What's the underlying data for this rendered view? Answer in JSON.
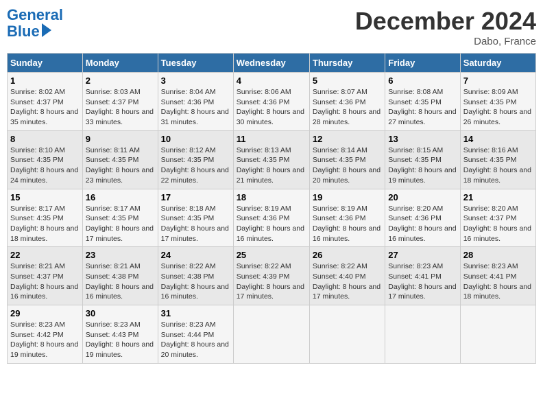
{
  "logo": {
    "line1": "General",
    "line2": "Blue"
  },
  "title": "December 2024",
  "subtitle": "Dabo, France",
  "days_header": [
    "Sunday",
    "Monday",
    "Tuesday",
    "Wednesday",
    "Thursday",
    "Friday",
    "Saturday"
  ],
  "weeks": [
    [
      {
        "day": "1",
        "sunrise": "8:02 AM",
        "sunset": "4:37 PM",
        "daylight": "8 hours and 35 minutes."
      },
      {
        "day": "2",
        "sunrise": "8:03 AM",
        "sunset": "4:37 PM",
        "daylight": "8 hours and 33 minutes."
      },
      {
        "day": "3",
        "sunrise": "8:04 AM",
        "sunset": "4:36 PM",
        "daylight": "8 hours and 31 minutes."
      },
      {
        "day": "4",
        "sunrise": "8:06 AM",
        "sunset": "4:36 PM",
        "daylight": "8 hours and 30 minutes."
      },
      {
        "day": "5",
        "sunrise": "8:07 AM",
        "sunset": "4:36 PM",
        "daylight": "8 hours and 28 minutes."
      },
      {
        "day": "6",
        "sunrise": "8:08 AM",
        "sunset": "4:35 PM",
        "daylight": "8 hours and 27 minutes."
      },
      {
        "day": "7",
        "sunrise": "8:09 AM",
        "sunset": "4:35 PM",
        "daylight": "8 hours and 26 minutes."
      }
    ],
    [
      {
        "day": "8",
        "sunrise": "8:10 AM",
        "sunset": "4:35 PM",
        "daylight": "8 hours and 24 minutes."
      },
      {
        "day": "9",
        "sunrise": "8:11 AM",
        "sunset": "4:35 PM",
        "daylight": "8 hours and 23 minutes."
      },
      {
        "day": "10",
        "sunrise": "8:12 AM",
        "sunset": "4:35 PM",
        "daylight": "8 hours and 22 minutes."
      },
      {
        "day": "11",
        "sunrise": "8:13 AM",
        "sunset": "4:35 PM",
        "daylight": "8 hours and 21 minutes."
      },
      {
        "day": "12",
        "sunrise": "8:14 AM",
        "sunset": "4:35 PM",
        "daylight": "8 hours and 20 minutes."
      },
      {
        "day": "13",
        "sunrise": "8:15 AM",
        "sunset": "4:35 PM",
        "daylight": "8 hours and 19 minutes."
      },
      {
        "day": "14",
        "sunrise": "8:16 AM",
        "sunset": "4:35 PM",
        "daylight": "8 hours and 18 minutes."
      }
    ],
    [
      {
        "day": "15",
        "sunrise": "8:17 AM",
        "sunset": "4:35 PM",
        "daylight": "8 hours and 18 minutes."
      },
      {
        "day": "16",
        "sunrise": "8:17 AM",
        "sunset": "4:35 PM",
        "daylight": "8 hours and 17 minutes."
      },
      {
        "day": "17",
        "sunrise": "8:18 AM",
        "sunset": "4:35 PM",
        "daylight": "8 hours and 17 minutes."
      },
      {
        "day": "18",
        "sunrise": "8:19 AM",
        "sunset": "4:36 PM",
        "daylight": "8 hours and 16 minutes."
      },
      {
        "day": "19",
        "sunrise": "8:19 AM",
        "sunset": "4:36 PM",
        "daylight": "8 hours and 16 minutes."
      },
      {
        "day": "20",
        "sunrise": "8:20 AM",
        "sunset": "4:36 PM",
        "daylight": "8 hours and 16 minutes."
      },
      {
        "day": "21",
        "sunrise": "8:20 AM",
        "sunset": "4:37 PM",
        "daylight": "8 hours and 16 minutes."
      }
    ],
    [
      {
        "day": "22",
        "sunrise": "8:21 AM",
        "sunset": "4:37 PM",
        "daylight": "8 hours and 16 minutes."
      },
      {
        "day": "23",
        "sunrise": "8:21 AM",
        "sunset": "4:38 PM",
        "daylight": "8 hours and 16 minutes."
      },
      {
        "day": "24",
        "sunrise": "8:22 AM",
        "sunset": "4:38 PM",
        "daylight": "8 hours and 16 minutes."
      },
      {
        "day": "25",
        "sunrise": "8:22 AM",
        "sunset": "4:39 PM",
        "daylight": "8 hours and 17 minutes."
      },
      {
        "day": "26",
        "sunrise": "8:22 AM",
        "sunset": "4:40 PM",
        "daylight": "8 hours and 17 minutes."
      },
      {
        "day": "27",
        "sunrise": "8:23 AM",
        "sunset": "4:41 PM",
        "daylight": "8 hours and 17 minutes."
      },
      {
        "day": "28",
        "sunrise": "8:23 AM",
        "sunset": "4:41 PM",
        "daylight": "8 hours and 18 minutes."
      }
    ],
    [
      {
        "day": "29",
        "sunrise": "8:23 AM",
        "sunset": "4:42 PM",
        "daylight": "8 hours and 19 minutes."
      },
      {
        "day": "30",
        "sunrise": "8:23 AM",
        "sunset": "4:43 PM",
        "daylight": "8 hours and 19 minutes."
      },
      {
        "day": "31",
        "sunrise": "8:23 AM",
        "sunset": "4:44 PM",
        "daylight": "8 hours and 20 minutes."
      },
      null,
      null,
      null,
      null
    ]
  ],
  "labels": {
    "sunrise": "Sunrise:",
    "sunset": "Sunset:",
    "daylight": "Daylight:"
  }
}
